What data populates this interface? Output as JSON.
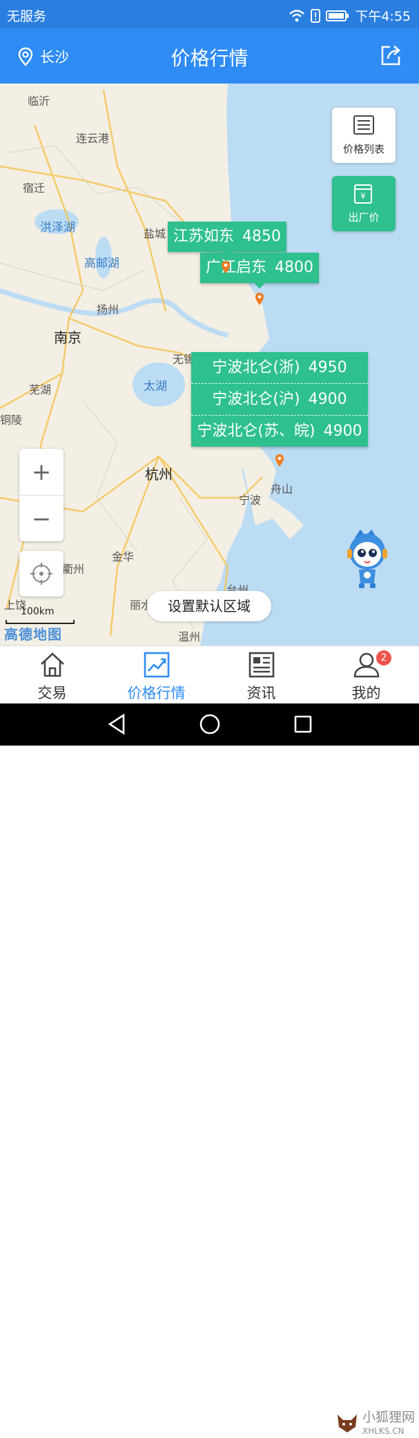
{
  "status_bar": {
    "carrier": "无服务",
    "time": "下午4:55",
    "icons": [
      "wifi-icon",
      "alert-icon",
      "battery-icon"
    ]
  },
  "header": {
    "location": "长沙",
    "title": "价格行情",
    "icons": [
      "location-pin-icon",
      "share-icon"
    ]
  },
  "map": {
    "cities": [
      {
        "name": "临沂"
      },
      {
        "name": "连云港"
      },
      {
        "name": "宿迁"
      },
      {
        "name": "盐城"
      },
      {
        "name": "扬州"
      },
      {
        "name": "南京"
      },
      {
        "name": "芜湖"
      },
      {
        "name": "铜陵"
      },
      {
        "name": "无锡"
      },
      {
        "name": "杭州"
      },
      {
        "name": "宁波"
      },
      {
        "name": "舟山"
      },
      {
        "name": "金华"
      },
      {
        "name": "衢州"
      },
      {
        "name": "上饶"
      },
      {
        "name": "丽水"
      },
      {
        "name": "台州"
      },
      {
        "name": "温州"
      }
    ],
    "lakes": [
      "洪泽湖",
      "高邮湖",
      "太湖"
    ],
    "side_buttons": {
      "price_list": "价格列表",
      "factory_price": "出厂价"
    },
    "price_tags": [
      {
        "place": "江苏如东",
        "price": "4850"
      },
      {
        "place": "广江启东",
        "price": "4800"
      }
    ],
    "price_group": [
      {
        "place": "宁波北仑(浙)",
        "price": "4950"
      },
      {
        "place": "宁波北仑(沪)",
        "price": "4900"
      },
      {
        "place": "宁波北仑(苏、皖)",
        "price": "4900"
      }
    ],
    "zoom_in": "+",
    "zoom_out": "−",
    "default_area_button": "设置默认区域",
    "scale_label": "100km",
    "map_brand": "高德地图",
    "colors": {
      "water": "#bcdcf4",
      "land": "#f3efe4",
      "tag": "#2ec08d",
      "accent": "#2f8cf5"
    }
  },
  "tabs": [
    {
      "label": "交易",
      "icon": "home-icon"
    },
    {
      "label": "价格行情",
      "icon": "trend-chart-icon",
      "active": true
    },
    {
      "label": "资讯",
      "icon": "news-icon"
    },
    {
      "label": "我的",
      "icon": "user-icon",
      "badge": "2"
    }
  ],
  "watermark": {
    "line1": "小狐狸网",
    "line2": "XHLKS.CN"
  }
}
